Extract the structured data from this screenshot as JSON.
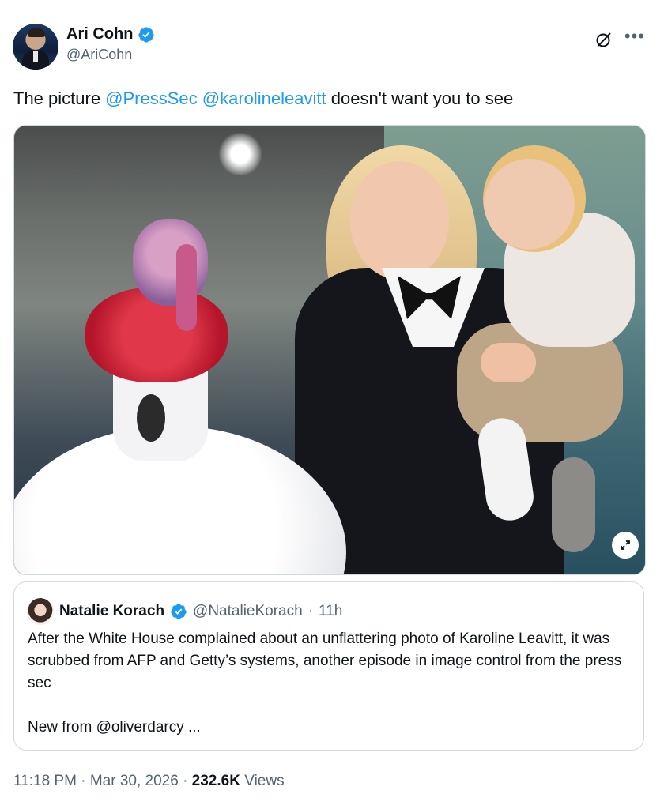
{
  "author": {
    "display_name": "Ari Cohn",
    "handle": "@AriCohn"
  },
  "tweet": {
    "text_prefix": "The picture ",
    "mention_1": "@PressSec",
    "mention_2": "@karolineleavitt",
    "text_suffix": " doesn't want you to see"
  },
  "quote": {
    "display_name": "Natalie Korach",
    "handle": "@NatalieKorach",
    "separator": "·",
    "time": "11h",
    "text": "After the White House complained about an unflattering photo of Karoline Leavitt, it was scrubbed from AFP and Getty’s systems, another episode in image control from the press sec\n\nNew from @oliverdarcy ..."
  },
  "meta": {
    "time": "11:18 PM",
    "dot": "·",
    "date": "Mar 30, 2026",
    "views_count": "232.6K",
    "views_label": "Views"
  },
  "icons": {
    "verified": "verified-badge-icon",
    "grok": "grok-icon",
    "more": "more-icon",
    "expand": "expand-icon"
  },
  "colors": {
    "accent": "#1d9bf0",
    "secondary_text": "#536471",
    "primary_text": "#0f1419"
  }
}
